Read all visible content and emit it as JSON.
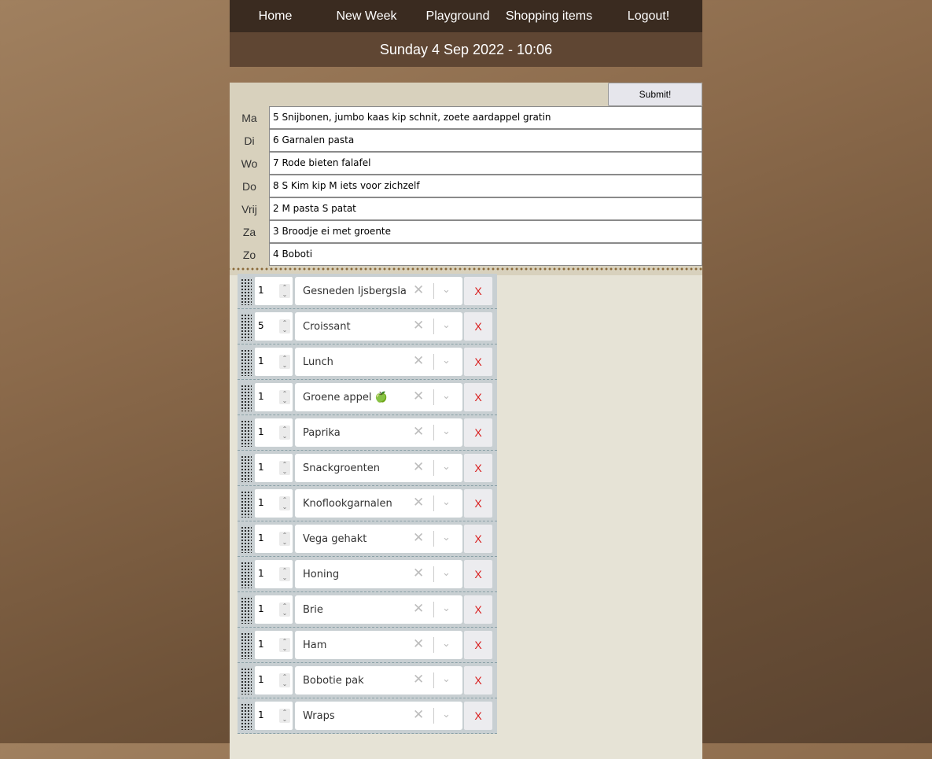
{
  "nav": {
    "items": [
      {
        "label": "Home"
      },
      {
        "label": "New Week"
      },
      {
        "label": "Playground"
      },
      {
        "label": "Shopping items"
      },
      {
        "label": "Logout!"
      }
    ]
  },
  "date_time": "Sunday 4 Sep 2022 - 10:06",
  "submit_label": "Submit!",
  "days": [
    {
      "label": "Ma",
      "value": "5 Snijbonen, jumbo kaas kip schnit, zoete aardappel gratin"
    },
    {
      "label": "Di",
      "value": "6 Garnalen pasta"
    },
    {
      "label": "Wo",
      "value": "7 Rode bieten falafel"
    },
    {
      "label": "Do",
      "value": "8 S Kim kip M iets voor zichzelf"
    },
    {
      "label": "Vrij",
      "value": "2 M pasta S patat"
    },
    {
      "label": "Za",
      "value": "3 Broodje ei met groente"
    },
    {
      "label": "Zo",
      "value": "4 Boboti"
    }
  ],
  "shopping_items": [
    {
      "qty": "1",
      "name": "Gesneden Ijsbergsla"
    },
    {
      "qty": "5",
      "name": "Croissant"
    },
    {
      "qty": "1",
      "name": "Lunch"
    },
    {
      "qty": "1",
      "name": "Groene appel 🍏"
    },
    {
      "qty": "1",
      "name": "Paprika"
    },
    {
      "qty": "1",
      "name": "Snackgroenten"
    },
    {
      "qty": "1",
      "name": "Knoflookgarnalen"
    },
    {
      "qty": "1",
      "name": "Vega gehakt"
    },
    {
      "qty": "1",
      "name": "Honing"
    },
    {
      "qty": "1",
      "name": "Brie"
    },
    {
      "qty": "1",
      "name": "Ham"
    },
    {
      "qty": "1",
      "name": "Bobotie pak"
    },
    {
      "qty": "1",
      "name": "Wraps"
    }
  ],
  "icons": {
    "clear": "✕",
    "dropdown": "chevron-down",
    "delete": "X",
    "spin": "spinner-arrows",
    "drag": "drag-handle"
  },
  "colors": {
    "navbar": "#3a2b20",
    "datebar": "#5f4633",
    "delete_text": "#d81b1b"
  }
}
